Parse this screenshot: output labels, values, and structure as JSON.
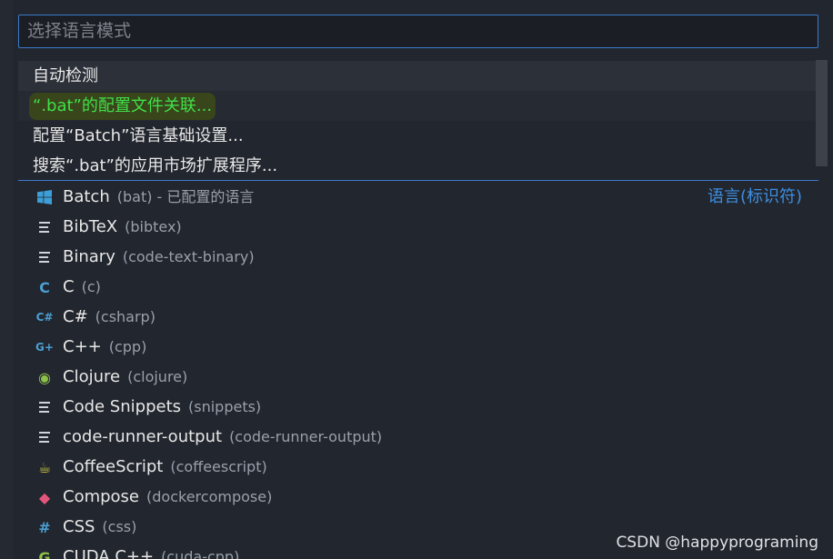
{
  "search": {
    "placeholder": "选择语言模式"
  },
  "actions": [
    {
      "label": "自动检测"
    },
    {
      "label": "“.bat”的配置文件关联..."
    },
    {
      "label": "配置“Batch”语言基础设置..."
    },
    {
      "label": "搜索“.bat”的应用市场扩展程序..."
    }
  ],
  "languages": [
    {
      "name": "Batch",
      "id": "(bat) - 已配置的语言",
      "icon": "windows-icon",
      "color": "#3e9fd8",
      "group": "语言(标识符)"
    },
    {
      "name": "BibTeX",
      "id": "(bibtex)",
      "icon": "lines-icon",
      "color": "#cfd3da"
    },
    {
      "name": "Binary",
      "id": "(code-text-binary)",
      "icon": "lines-icon",
      "color": "#cfd3da"
    },
    {
      "name": "C",
      "id": "(c)",
      "icon": "c-icon",
      "glyph": "C",
      "color": "#4a9fd3"
    },
    {
      "name": "C#",
      "id": "(csharp)",
      "icon": "csharp-icon",
      "glyph": "C#",
      "color": "#4a9fd3"
    },
    {
      "name": "C++",
      "id": "(cpp)",
      "icon": "cpp-icon",
      "glyph": "G+",
      "color": "#4a9fd3"
    },
    {
      "name": "Clojure",
      "id": "(clojure)",
      "icon": "clojure-icon",
      "glyph": "◉",
      "color": "#8dc149"
    },
    {
      "name": "Code Snippets",
      "id": "(snippets)",
      "icon": "lines-icon",
      "color": "#cfd3da"
    },
    {
      "name": "code-runner-output",
      "id": "(code-runner-output)",
      "icon": "lines-icon",
      "color": "#cfd3da"
    },
    {
      "name": "CoffeeScript",
      "id": "(coffeescript)",
      "icon": "coffee-icon",
      "glyph": "☕",
      "color": "#cbcb41"
    },
    {
      "name": "Compose",
      "id": "(dockercompose)",
      "icon": "docker-icon",
      "glyph": "◆",
      "color": "#e2567c"
    },
    {
      "name": "CSS",
      "id": "(css)",
      "icon": "hash-icon",
      "glyph": "#",
      "color": "#4a9fd3"
    },
    {
      "name": "CUDA C++",
      "id": "(cuda-cpp)",
      "icon": "cuda-icon",
      "glyph": "G",
      "color": "#8dc149"
    }
  ],
  "watermark": "CSDN @happyprograming"
}
